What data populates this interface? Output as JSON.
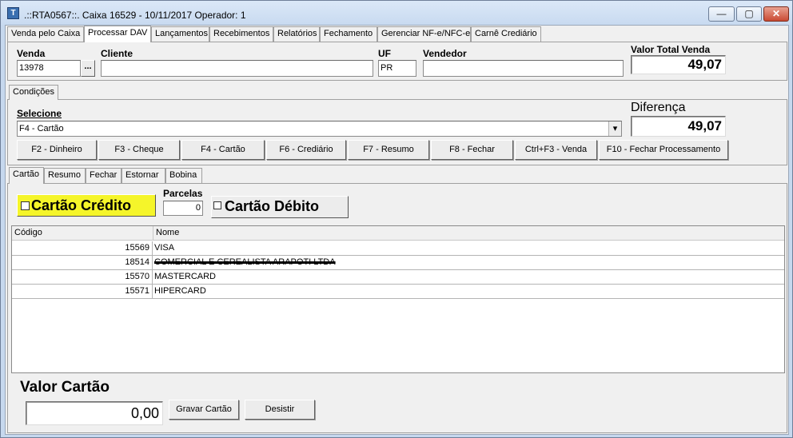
{
  "window": {
    "title": ".::RTA0567::. Caixa 16529 - 10/11/2017 Operador: 1",
    "app_icon_glyph": "T",
    "minimize_glyph": "—",
    "maximize_glyph": "▢",
    "close_glyph": "✕"
  },
  "main_tabs": [
    {
      "label": "Venda pelo Caixa"
    },
    {
      "label": "Processar DAV"
    },
    {
      "label": "Lançamentos"
    },
    {
      "label": "Recebimentos"
    },
    {
      "label": "Relatórios"
    },
    {
      "label": "Fechamento"
    },
    {
      "label": "Gerenciar NF-e/NFC-e"
    },
    {
      "label": "Carnê Crediário"
    }
  ],
  "header": {
    "venda_label": "Venda",
    "venda_value": "13978",
    "lookup_button": "...",
    "cliente_label": "Cliente",
    "cliente_value": "",
    "uf_label": "UF",
    "uf_value": "PR",
    "vendedor_label": "Vendedor",
    "vendedor_value": "",
    "valor_total_label": "Valor Total Venda",
    "valor_total_value": "49,07"
  },
  "condicoes_tab": "Condições",
  "selecione": {
    "label": "Selecione",
    "value": "F4 - Cartão",
    "dropdown_glyph": "▾",
    "diferenca_label": "Diferença",
    "diferenca_value": "49,07"
  },
  "action_buttons": [
    {
      "label": "F2 - Dinheiro"
    },
    {
      "label": "F3 - Cheque"
    },
    {
      "label": "F4 - Cartão"
    },
    {
      "label": "F6 - Crediário"
    },
    {
      "label": "F7 - Resumo"
    },
    {
      "label": "F8 - Fechar"
    },
    {
      "label": "Ctrl+F3 - Venda"
    },
    {
      "label": "F10 - Fechar Processamento"
    }
  ],
  "sub_tabs": [
    {
      "label": "Cartão"
    },
    {
      "label": "Resumo"
    },
    {
      "label": "Fechar"
    },
    {
      "label": "Estornar"
    },
    {
      "label": "Bobina"
    }
  ],
  "card_type": {
    "credito_label": "Cartão Crédito",
    "parcelas_label": "Parcelas",
    "parcelas_value": "0",
    "debito_label": "Cartão Débito"
  },
  "grid": {
    "columns": [
      "Código",
      "Nome"
    ],
    "rows": [
      {
        "codigo": "15569",
        "nome": "VISA"
      },
      {
        "codigo": "18514",
        "nome": "COMERCIAL E CEREALISTA ARAPOTI LTDA"
      },
      {
        "codigo": "15570",
        "nome": "MASTERCARD"
      },
      {
        "codigo": "15571",
        "nome": "HIPERCARD"
      }
    ]
  },
  "footer": {
    "valor_cartao_label": "Valor Cartão",
    "valor_cartao_value": "0,00",
    "gravar_button": "Gravar Cartão",
    "desistir_button": "Desistir"
  }
}
